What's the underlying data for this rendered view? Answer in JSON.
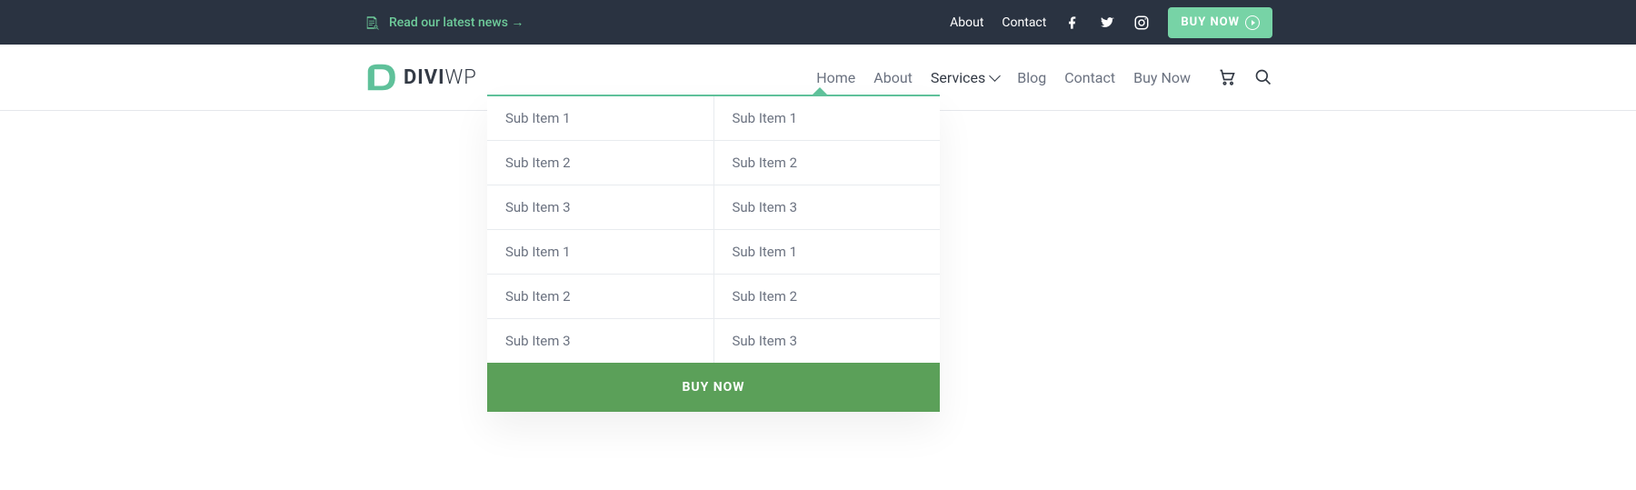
{
  "topbar": {
    "news": "Read our latest news →",
    "about": "About",
    "contact": "Contact",
    "buy": "BUY NOW"
  },
  "logo": {
    "bold": "DIVI",
    "thin": "WP"
  },
  "nav": {
    "home": "Home",
    "about": "About",
    "services": "Services",
    "blog": "Blog",
    "contact": "Contact",
    "buy": "Buy Now"
  },
  "dropdown": {
    "col1": [
      "Sub Item 1",
      "Sub Item 2",
      "Sub Item 3",
      "Sub Item 1",
      "Sub Item 2",
      "Sub Item 3"
    ],
    "col2": [
      "Sub Item 1",
      "Sub Item 2",
      "Sub Item 3",
      "Sub Item 1",
      "Sub Item 2",
      "Sub Item 3"
    ],
    "footer": "BUY NOW"
  }
}
